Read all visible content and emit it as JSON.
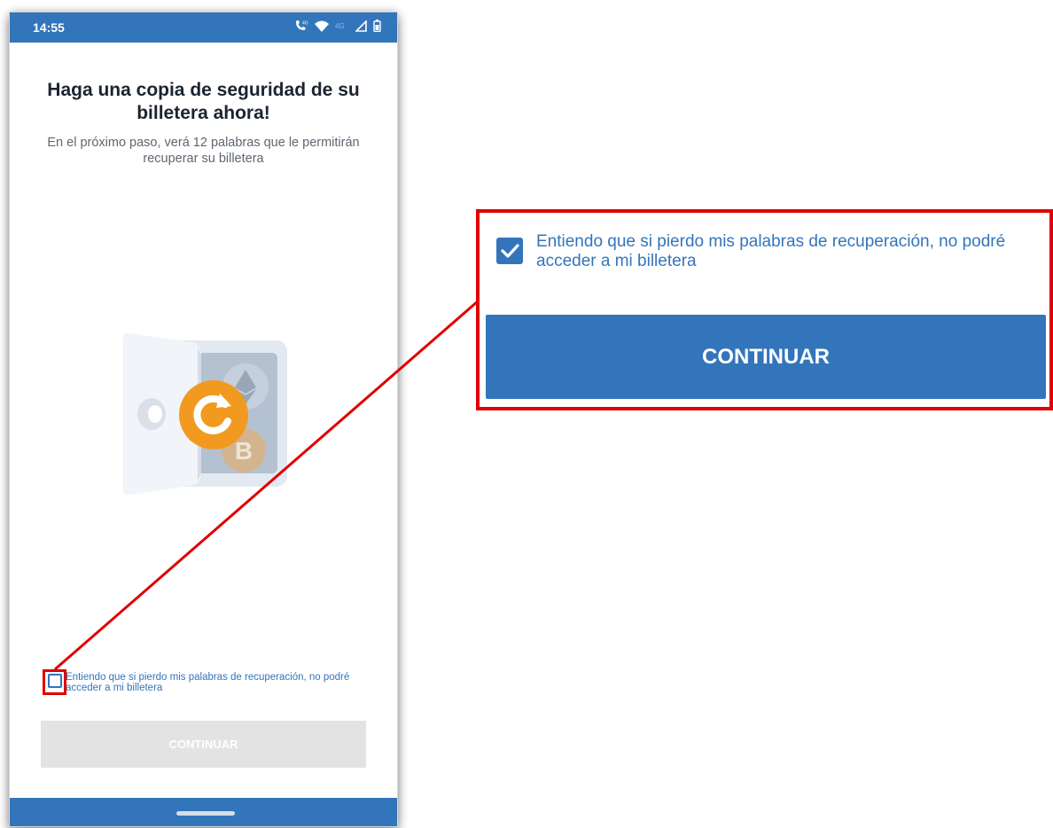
{
  "status_bar": {
    "time": "14:55",
    "icons": [
      "call-4g-icon",
      "wifi-icon",
      "4g-signal-icon",
      "cell-signal-icon",
      "battery-icon"
    ],
    "background": "#3375bb"
  },
  "backup_screen": {
    "title": "Haga una copia de seguridad de su billetera ahora!",
    "subtitle": "En el próximo paso, verá 12 palabras que le permitirán recuperar su billetera",
    "illustration": "wallet-safe-illustration",
    "checkbox": {
      "label": "Entiendo que si pierdo mis palabras de recuperación, no podré acceder a mi billetera",
      "checked": false
    },
    "continue_button": {
      "label": "CONTINUAR",
      "enabled": false
    }
  },
  "zoom_callout": {
    "checkbox": {
      "label": "Entiendo que si pierdo mis palabras de recuperación, no podré acceder a mi billetera",
      "checked": true
    },
    "continue_button": {
      "label": "CONTINUAR",
      "enabled": true
    }
  },
  "colors": {
    "accent": "#3375bb",
    "highlight": "#e00000",
    "disabled_button": "#e3e3e3",
    "refresh_orange": "#f29a1f"
  }
}
